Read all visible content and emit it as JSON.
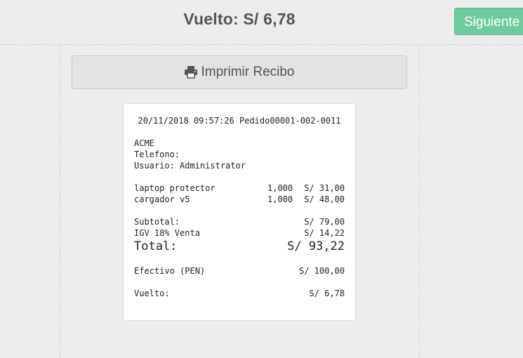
{
  "header": {
    "change_title": "Vuelto: S/ 6,78",
    "next_label": "Siguiente"
  },
  "actions": {
    "print_label": "Imprimir Recibo",
    "print_icon": "print-icon"
  },
  "receipt": {
    "datetime": "20/11/2018 09:57:26",
    "order": "Pedido00001-002-0011",
    "company": "ACME",
    "phone_label": "Telefono:",
    "user_label": "Usuario: Administrator",
    "items": [
      {
        "name": "laptop protector",
        "qty": "1,000",
        "price": "S/ 31,00"
      },
      {
        "name": "cargador v5",
        "qty": "1,000",
        "price": "S/ 48,00"
      }
    ],
    "subtotal_label": "Subtotal:",
    "subtotal_value": "S/ 79,00",
    "tax_label": "IGV 18% Venta",
    "tax_value": "S/ 14,22",
    "total_label": "Total:",
    "total_value": "S/ 93,22",
    "payment_label": "Efectivo (PEN)",
    "payment_value": "S/ 100,00",
    "change_label": "Vuelto:",
    "change_value": "S/ 6,78"
  }
}
